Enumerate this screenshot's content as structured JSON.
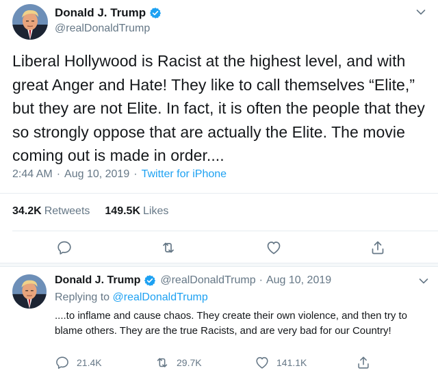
{
  "main_tweet": {
    "author": {
      "name": "Donald J. Trump",
      "handle": "@realDonaldTrump",
      "verified_icon": "verified-badge-icon"
    },
    "text": "Liberal Hollywood is Racist at the highest level, and with great Anger and Hate! They like to call themselves “Elite,” but they are not Elite. In fact, it is often the people that they so strongly oppose that are actually the Elite. The movie coming out is made in order....",
    "time": "2:44 AM",
    "date": "Aug 10, 2019",
    "separator": "·",
    "source": "Twitter for iPhone",
    "retweets_count": "34.2K",
    "retweets_label": "Retweets",
    "likes_count": "149.5K",
    "likes_label": "Likes",
    "actions": [
      "reply-icon",
      "retweet-icon",
      "like-icon",
      "share-icon"
    ]
  },
  "reply_tweet": {
    "author": {
      "name": "Donald J. Trump",
      "handle": "@realDonaldTrump",
      "date": "Aug 10, 2019"
    },
    "replying_prefix": "Replying to",
    "replying_to": "@realDonaldTrump",
    "text": "....to inflame and cause chaos. They create their own violence, and then try to blame others. They are the true Racists, and are very bad for our Country!",
    "reply_count": "21.4K",
    "retweet_count": "29.7K",
    "like_count": "141.1K"
  },
  "colors": {
    "accent": "#1da1f2",
    "text": "#14171a",
    "secondary": "#657786",
    "divider": "#e6ecf0"
  }
}
